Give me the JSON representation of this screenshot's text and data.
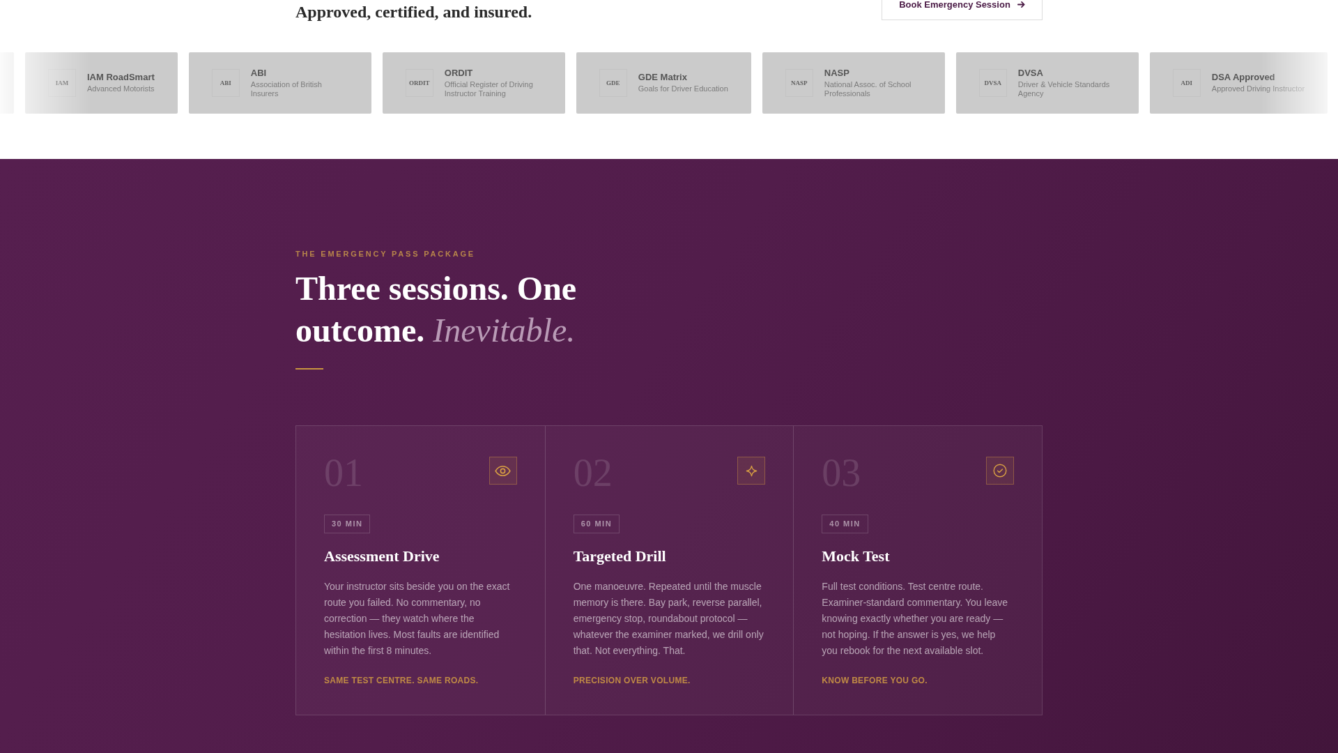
{
  "intro": {
    "heading": "Approved, certified, and insured.",
    "cta": "Book Emergency Session"
  },
  "partners": [
    {
      "mark": "IAM",
      "name": "IAM RoadSmart",
      "caption": "Advanced Motorists"
    },
    {
      "mark": "ABI",
      "name": "ABI",
      "caption": "Association of British Insurers"
    },
    {
      "mark": "ORDIT",
      "name": "ORDIT",
      "caption": "Official Register of Driving Instructor Training"
    },
    {
      "mark": "GDE",
      "name": "GDE Matrix",
      "caption": "Goals for Driver Education"
    },
    {
      "mark": "NASP",
      "name": "NASP",
      "caption": "National Assoc. of School Professionals"
    },
    {
      "mark": "DVSA",
      "name": "DVSA",
      "caption": "Driver & Vehicle Standards Agency"
    },
    {
      "mark": "ADI",
      "name": "DSA Approved",
      "caption": "Approved Driving Instructor"
    }
  ],
  "package": {
    "eyebrow": "THE EMERGENCY PASS PACKAGE",
    "heading": "Three sessions. One outcome. *Inevitable.*",
    "steps": [
      {
        "number": "01",
        "duration": "30 MIN",
        "title": "Assessment Drive",
        "body": "Your instructor sits beside you on the exact route you failed. No commentary, no correction — they watch where the hesitation lives. Most faults are identified within the first 8 minutes.",
        "tagline": "SAME TEST CENTRE. SAME ROADS."
      },
      {
        "number": "02",
        "duration": "60 MIN",
        "title": "Targeted Drill",
        "body": "One manoeuvre. Repeated until the muscle memory is there. Bay park, reverse parallel, emergency stop, roundabout protocol — whatever the examiner marked, we drill only that. Not everything. That.",
        "tagline": "PRECISION OVER VOLUME."
      },
      {
        "number": "03",
        "duration": "40 MIN",
        "title": "Mock Test",
        "body": "Full test conditions. Test centre route. Examiner-standard commentary. You leave knowing exactly whether you are ready — not hoping. If the answer is yes, we help you rebook for the next available slot.",
        "tagline": "KNOW BEFORE YOU GO."
      }
    ]
  }
}
